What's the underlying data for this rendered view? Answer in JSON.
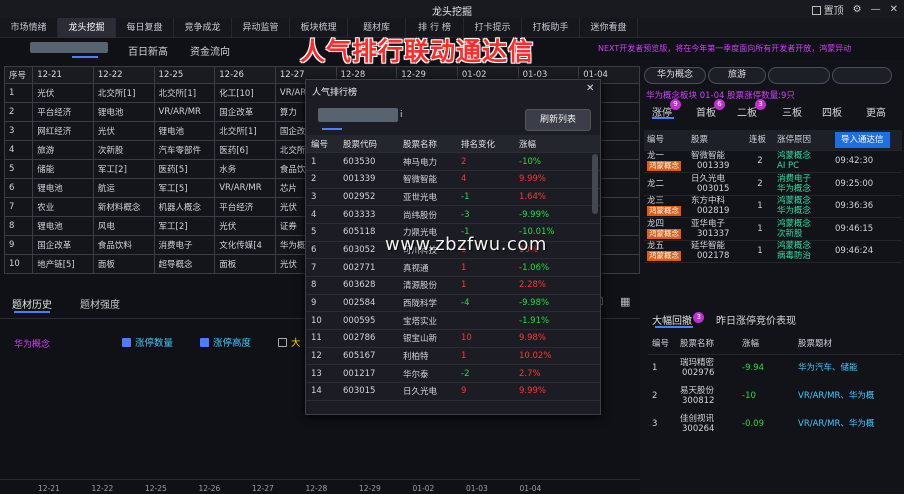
{
  "app": {
    "title": "龙头挖掘",
    "checkbox_label": "置顶"
  },
  "nav": [
    "市场情绪",
    "龙头挖掘",
    "每日复盘",
    "竞争成龙",
    "异动监管",
    "板块梳理",
    "题材库",
    "排 行 榜",
    "打卡提示",
    "打板助手",
    "迷你看盘"
  ],
  "subtabs": [
    "百日新高",
    "资金流向"
  ],
  "headline": "人气排行联动通达信",
  "ticker": "NEXT开发者预览版，将在今年第一季度面向所有开发者开放，鸿蒙异动",
  "main_table": {
    "headers": [
      "序号",
      "12-21",
      "12-22",
      "12-25",
      "12-26",
      "12-27",
      "12-28",
      "12-29",
      "01-02",
      "01-03",
      "01-04"
    ],
    "rows": [
      {
        "n": "1",
        "c": [
          "光伏",
          "北交所[1]",
          "北交所[1]",
          "化工[10]",
          "VR/AR/MR",
          "",
          "",
          "",
          "",
          ""
        ]
      },
      {
        "n": "2",
        "c": [
          "平台经济",
          "锂电池",
          "VR/AR/MR",
          "国企改革",
          "算力",
          "",
          "",
          "",
          "",
          ""
        ]
      },
      {
        "n": "3",
        "c": [
          "网红经济",
          "光伏",
          "锂电池",
          "北交所[1]",
          "国企改革",
          "",
          "",
          "",
          "",
          ""
        ]
      },
      {
        "n": "4",
        "c": [
          "旅游",
          "次新股",
          "汽车零部件",
          "医药[6]",
          "北交所",
          "",
          "",
          "",
          "",
          "概念"
        ]
      },
      {
        "n": "5",
        "c": [
          "储能",
          "军工[2]",
          "医药[5]",
          "水务",
          "食品饮料",
          "",
          "",
          "",
          "",
          ""
        ]
      },
      {
        "n": "6",
        "c": [
          "锂电池",
          "航运",
          "军工[5]",
          "VR/AR/MR",
          "芯片",
          "",
          "",
          "",
          "",
          ""
        ]
      },
      {
        "n": "7",
        "c": [
          "农业",
          "新材料概念",
          "机器人概念",
          "平台经济",
          "光伏",
          "",
          "",
          "",
          "",
          ""
        ]
      },
      {
        "n": "8",
        "c": [
          "锂电池",
          "风电",
          "军工[2]",
          "光伏",
          "证券",
          "",
          "",
          "",
          "",
          "动"
        ]
      },
      {
        "n": "9",
        "c": [
          "国企改革",
          "食品饮料",
          "消费电子",
          "文化传媒[4",
          "华为概念",
          "",
          "",
          "",
          "",
          ""
        ]
      },
      {
        "n": "10",
        "c": [
          "地产链[5]",
          "面板",
          "超导概念",
          "面板",
          "光伏",
          "",
          "",
          "",
          "",
          ""
        ]
      }
    ]
  },
  "bottom_tabs": [
    "题材历史",
    "题材强度"
  ],
  "bottom": {
    "series_label": "华为概念",
    "legend": [
      "涨停数量",
      "涨停高度",
      "大"
    ],
    "x_ticks": [
      "12-21",
      "12-22",
      "12-25",
      "12-26",
      "12-27",
      "12-28",
      "12-29",
      "01-02",
      "01-03",
      "01-04"
    ]
  },
  "popup": {
    "title": "人气排行榜",
    "close": "✕",
    "refresh": "刷新列表",
    "edit_suffix": "i",
    "headers": [
      "编号",
      "股票代码",
      "股票名称",
      "排名变化",
      "涨幅"
    ],
    "rows": [
      {
        "n": "1",
        "code": "603530",
        "name": "神马电力",
        "rank": "2",
        "rc": "red",
        "chg": "-10%",
        "cc": "green"
      },
      {
        "n": "2",
        "code": "001339",
        "name": "智微智能",
        "rank": "4",
        "rc": "red",
        "chg": "9.99%",
        "cc": "red"
      },
      {
        "n": "3",
        "code": "002952",
        "name": "亚世光电",
        "rank": "-1",
        "rc": "green",
        "chg": "1.64%",
        "cc": "red"
      },
      {
        "n": "4",
        "code": "603333",
        "name": "尚纬股份",
        "rank": "-3",
        "rc": "green",
        "chg": "-9.99%",
        "cc": "green"
      },
      {
        "n": "5",
        "code": "605118",
        "name": "力鼎光电",
        "rank": "-1",
        "rc": "green",
        "chg": "-10.01%",
        "cc": "green"
      },
      {
        "n": "6",
        "code": "603052",
        "name": "可川科技",
        "rank": "1",
        "rc": "red",
        "chg": "10%",
        "cc": "red"
      },
      {
        "n": "7",
        "code": "002771",
        "name": "真视通",
        "rank": "1",
        "rc": "red",
        "chg": "-1.06%",
        "cc": "green"
      },
      {
        "n": "8",
        "code": "603628",
        "name": "清源股份",
        "rank": "1",
        "rc": "red",
        "chg": "2.28%",
        "cc": "red"
      },
      {
        "n": "9",
        "code": "002584",
        "name": "西陇科学",
        "rank": "-4",
        "rc": "green",
        "chg": "-9.98%",
        "cc": "green"
      },
      {
        "n": "10",
        "code": "000595",
        "name": "宝塔实业",
        "rank": "",
        "rc": "red",
        "chg": "-1.91%",
        "cc": "green"
      },
      {
        "n": "11",
        "code": "002786",
        "name": "银宝山新",
        "rank": "10",
        "rc": "red",
        "chg": "9.98%",
        "cc": "red"
      },
      {
        "n": "12",
        "code": "605167",
        "name": "利柏特",
        "rank": "1",
        "rc": "red",
        "chg": "10.02%",
        "cc": "red"
      },
      {
        "n": "13",
        "code": "001217",
        "name": "华尔泰",
        "rank": "-2",
        "rc": "green",
        "chg": "2.7%",
        "cc": "red"
      },
      {
        "n": "14",
        "code": "603015",
        "name": "日久光电",
        "rank": "9",
        "rc": "red",
        "chg": "9.99%",
        "cc": "red"
      }
    ]
  },
  "watermark": "www.zbzfwu.com",
  "right": {
    "pills": [
      "华为概念",
      "旅游",
      "",
      ""
    ],
    "info": "华为概念板块 01-04   股票涨停数量:9只",
    "tabs": [
      {
        "label": "涨停",
        "badge": "9"
      },
      {
        "label": "首板",
        "badge": "6"
      },
      {
        "label": "二板",
        "badge": "3"
      },
      {
        "label": "三板",
        "badge": ""
      },
      {
        "label": "四板",
        "badge": ""
      },
      {
        "label": "更高",
        "badge": ""
      }
    ],
    "dragon_headers": [
      "编号",
      "股票",
      "连板",
      "涨停原因"
    ],
    "import_btn": "导入通达信",
    "dragons": [
      {
        "rank": "龙一",
        "tag": "鸿蒙概念",
        "name": "智微智能",
        "code": "001339",
        "boards": "2",
        "r1": "鸿蒙概念",
        "r2": "AI PC",
        "time": "09:42:30"
      },
      {
        "rank": "龙二",
        "tag": "",
        "name": "日久光电",
        "code": "003015",
        "boards": "2",
        "r1": "消费电子",
        "r2": "华为概念",
        "time": "09:25:00"
      },
      {
        "rank": "龙三",
        "tag": "鸿蒙概念",
        "name": "东方中科",
        "code": "002819",
        "boards": "1",
        "r1": "鸿蒙概念",
        "r2": "华为概念",
        "time": "09:36:36"
      },
      {
        "rank": "龙四",
        "tag": "鸿蒙概念",
        "name": "亚华电子",
        "code": "301337",
        "boards": "1",
        "r1": "鸿蒙概念",
        "r2": "次新股",
        "time": "09:46:15"
      },
      {
        "rank": "龙五",
        "tag": "鸿蒙概念",
        "name": "延华智能",
        "code": "002178",
        "boards": "1",
        "r1": "鸿蒙概念",
        "r2": "病毒防治",
        "time": "09:46:24"
      }
    ],
    "bigrev_title": "大幅回撤",
    "bigrev_badge": "3",
    "bigrev_sub": "昨日涨停竞价表现",
    "bigrev_headers": [
      "编号",
      "股票名称",
      "涨幅",
      "股票题材"
    ],
    "bigrev": [
      {
        "n": "1",
        "name": "瑞玛精密",
        "code": "002976",
        "chg": "-9.94",
        "theme": "华为汽车、储能"
      },
      {
        "n": "2",
        "name": "易天股份",
        "code": "300812",
        "chg": "-10",
        "theme": "VR/AR/MR、华为概"
      },
      {
        "n": "3",
        "name": "佳创视讯",
        "code": "300264",
        "chg": "-0.09",
        "theme": "VR/AR/MR、华为概"
      }
    ]
  }
}
